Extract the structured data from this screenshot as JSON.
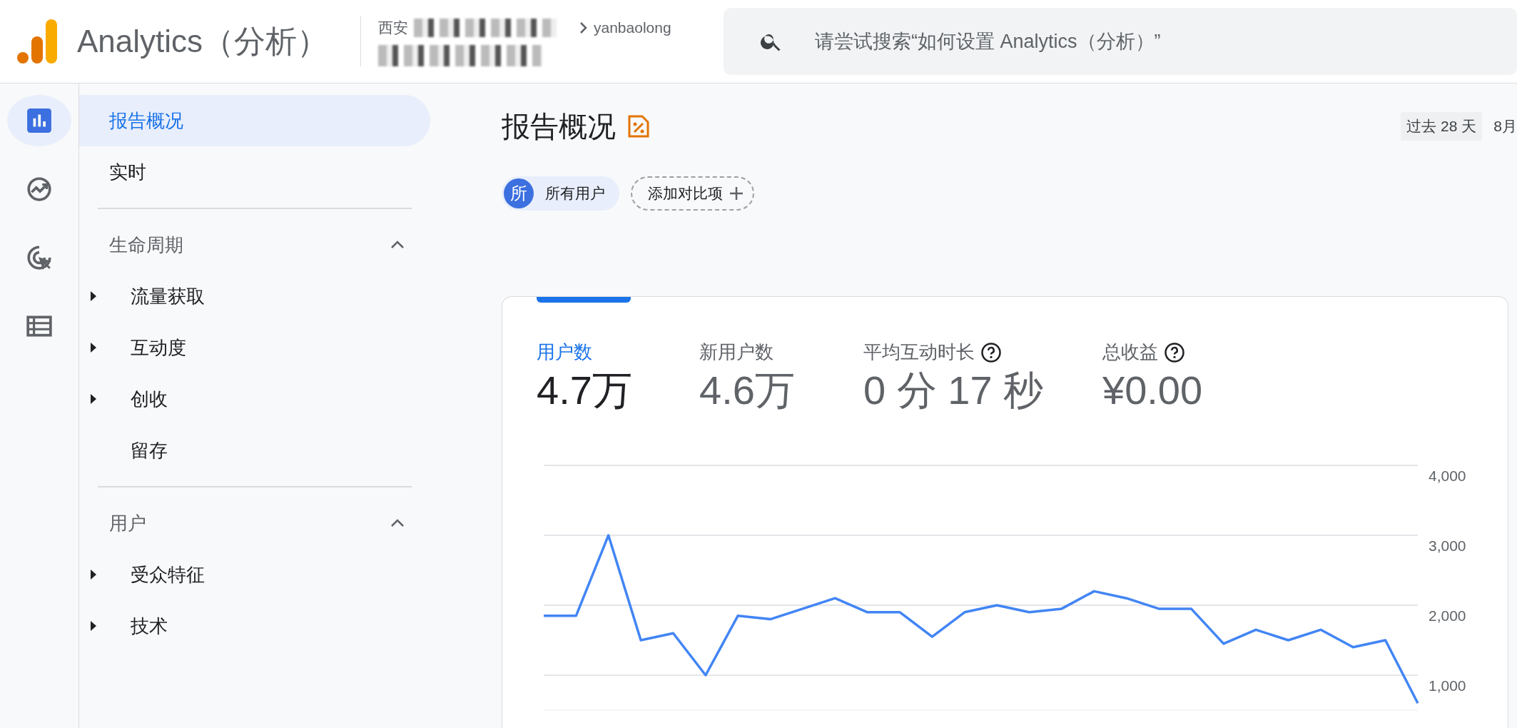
{
  "header": {
    "product_name": "Analytics（分析）",
    "account": {
      "location": "西安",
      "property": "yanbaolong"
    },
    "search": {
      "placeholder": "请尝试搜索“如何设置 Analytics（分析）”"
    }
  },
  "rail": {
    "items": [
      {
        "kind": "reports",
        "selected": true
      },
      {
        "kind": "explore",
        "selected": false
      },
      {
        "kind": "advertising",
        "selected": false
      },
      {
        "kind": "configure",
        "selected": false
      }
    ]
  },
  "nav": {
    "items": [
      {
        "label": "报告概况",
        "selected": true
      },
      {
        "label": "实时",
        "selected": false
      }
    ],
    "sections": [
      {
        "title": "生命周期",
        "expanded": true,
        "items": [
          {
            "label": "流量获取",
            "has_children": true
          },
          {
            "label": "互动度",
            "has_children": true
          },
          {
            "label": "创收",
            "has_children": true
          },
          {
            "label": "留存",
            "has_children": false
          }
        ]
      },
      {
        "title": "用户",
        "expanded": true,
        "items": [
          {
            "label": "受众特征",
            "has_children": true
          },
          {
            "label": "技术",
            "has_children": true
          }
        ]
      }
    ]
  },
  "page": {
    "title": "报告概况",
    "date_range": "过去 28 天",
    "date_text": "8月",
    "comparisons": [
      {
        "kind": "segment",
        "avatar": "所",
        "label": "所有用户"
      },
      {
        "kind": "add",
        "label": "添加对比项"
      }
    ],
    "metrics": [
      {
        "label": "用户数",
        "value": "4.7万",
        "selected": true,
        "help": false
      },
      {
        "label": "新用户数",
        "value": "4.6万",
        "selected": false,
        "help": false
      },
      {
        "label": "平均互动时长",
        "value": "0 分 17 秒",
        "selected": false,
        "help": true
      },
      {
        "label": "总收益",
        "value": "¥0.00",
        "selected": false,
        "help": true
      }
    ],
    "chart_data": {
      "type": "line",
      "grid": true,
      "ylim": [
        500,
        4000
      ],
      "yticks": [
        {
          "value": 1000,
          "label": "1,000"
        },
        {
          "value": 2000,
          "label": "2,000"
        },
        {
          "value": 3000,
          "label": "3,000"
        },
        {
          "value": 4000,
          "label": "4,000"
        }
      ],
      "series": [
        {
          "color": "#4285f4",
          "values": [
            1850,
            1850,
            3000,
            1500,
            1600,
            1000,
            1850,
            1800,
            1950,
            2100,
            1900,
            1900,
            1550,
            1900,
            2000,
            1900,
            1950,
            2200,
            2100,
            1950,
            1950,
            1450,
            1650,
            1500,
            1650,
            1400,
            1500,
            600
          ]
        }
      ]
    }
  }
}
